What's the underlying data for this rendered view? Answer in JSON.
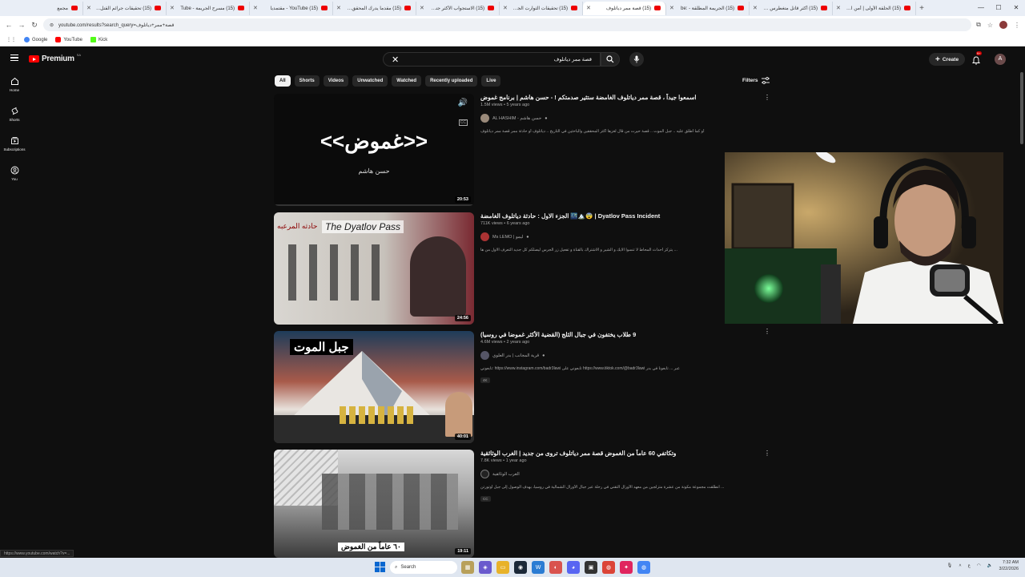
{
  "browser": {
    "tabs": [
      {
        "label": "مجمع"
      },
      {
        "label": "(15) تحقيقات جرائم القتل..."
      },
      {
        "label": "(15) مسرح الجريمة - Tube"
      },
      {
        "label": "(15) YouTube - مقتمديا"
      },
      {
        "label": "(15) مقدما يدرك المحقق أن..."
      },
      {
        "label": "(15) الاستجواب الأكثر جنوناً..."
      },
      {
        "label": "(15) تحقيقات الثوارت الجنا..."
      },
      {
        "label": "(15) قصة ممر دياتلوف"
      },
      {
        "label": "(15) الجريمة المطلقة - :be"
      },
      {
        "label": "(15) أكثر قاتل متغطرس بال..."
      },
      {
        "label": "(15) الحلقة الأولى | أمن ال..."
      }
    ],
    "new_tab": "+",
    "address": "youtube.com/results?search_query=قصة+ممر+دياتلوف",
    "bookmarks": [
      "Google",
      "YouTube",
      "Kick"
    ]
  },
  "header": {
    "logo": "Premium",
    "region": "SA",
    "search_query": "قصة ممر دياتلوف",
    "create_label": "Create",
    "notif_count": "9+",
    "avatar_letter": "A"
  },
  "sidebar": {
    "items": [
      {
        "label": "Home",
        "icon": "home-icon"
      },
      {
        "label": "Shorts",
        "icon": "shorts-icon"
      },
      {
        "label": "Subscriptions",
        "icon": "subscriptions-icon"
      },
      {
        "label": "You",
        "icon": "you-icon"
      }
    ]
  },
  "chips": [
    "All",
    "Shorts",
    "Videos",
    "Unwatched",
    "Watched",
    "Recently uploaded",
    "Live"
  ],
  "filters_label": "Filters",
  "results": [
    {
      "title": "اسمعوا جيداً ، قصة ممر دياتلوف الغامضة ستثير صدمتكم ! - حسن هاشم | برنامج غموض",
      "stats": "1.5M views • 5 years ago",
      "channel": "AL HASHIM - حسن هاشم",
      "desc": "أو كما أطلق عليه .. جبل الموت .. قصة حيرت من قال لغزها أكثر المحققين والباحثين في التاريخ .. دياتلوف أو حادثة ممر قصة ممر دياتلوف",
      "duration": "20:53",
      "thumb_text": "<<غموض>>",
      "thumb_sub": "حسن هاشم"
    },
    {
      "title": "Dyatlov Pass Incident | 😨🏔️🌃 الجزء الاول : حادثة دياتلوف الغامضة",
      "stats": "711K views • 6 years ago",
      "channel": "Ms LEMO | ليمو",
      "desc": "... يتركز أحداث المحاط لا تنسوا الايك و الشير و الاشتراك بالقناة و تفعيل زر الجرس ليصلكم كل جديد التعرف الاول من ها",
      "duration": "24:56",
      "thumb_text": "The Dyatlov Pass",
      "thumb_sub": "حادثه المرعبه"
    },
    {
      "title": "9 طلاب يختفون في جبال الثلج (القضية الأكثر غموضا في روسيا)",
      "stats": "4.6M views • 2 years ago",
      "channel": "قرية المجانب | بدر العلوي",
      "desc": "تابعوني: https://www.instagram.com/badr3lawi تابعوني على https://www.tiktok.com/@badr3lawi عبر ... تابعونا في بدر",
      "tag": "4K",
      "duration": "40:01",
      "thumb_text": "جبل الموت"
    },
    {
      "title": "وتكاتفي 60 عاماً من الغموض قصة ممر دياتلوف تروى من جديد | الغرب الوثائقية",
      "stats": "7.8K views • 1 year ago",
      "channel": "الغرب الوثائقية",
      "desc": "... انطلقت مجموعة مكونة من عشرة متزلجين من معهد الأورال التقني في رحلة عبر جبال الأورال الشمالية في روسيا، بهدف الوصول إلى جبل أوتورتن",
      "tag": "CC",
      "duration": "19:11",
      "thumb_text": "٦٠ عاماً من الغموض"
    }
  ],
  "status_url": "https://www.youtube.com/watch?v=...",
  "taskbar": {
    "search_label": "Search",
    "time": "7:32 AM",
    "date": "3/22/2026",
    "lang": "ع"
  }
}
